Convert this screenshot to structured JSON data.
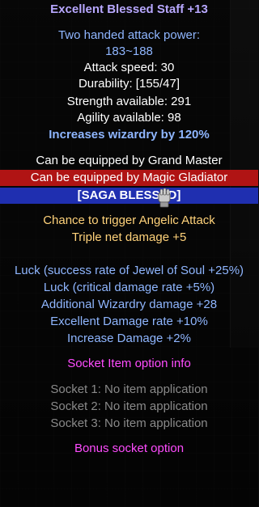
{
  "item": {
    "title": "Excellent Blessed Staff +13",
    "attack_power_label": "Two handed attack power:",
    "attack_power_value": "183~188",
    "attack_speed": "Attack speed: 30",
    "durability": "Durability: [155/47]",
    "strength": "Strength available: 291",
    "agility": "Agility available: 98",
    "wizardry": "Increases wizardry by 120%",
    "equip_grand_master": "Can be equipped by Grand Master",
    "equip_magic_gladiator": "Can be equipped by Magic Gladiator",
    "saga": "[SAGA BLESSED]",
    "angelic_attack": "Chance to trigger Angelic Attack",
    "triple_net": "Triple net damage +5",
    "luck_jewel": "Luck (success rate of Jewel of Soul +25%)",
    "luck_crit": "Luck (critical damage rate +5%)",
    "additional_wizardry": "Additional Wizardry damage +28",
    "excellent_rate": "Excellent Damage rate +10%",
    "increase_damage": "Increase Damage +2%",
    "socket_info": "Socket Item option info",
    "socket_1": "Socket 1: No item application",
    "socket_2": "Socket 2: No item application",
    "socket_3": "Socket 3: No item application",
    "bonus_socket": "Bonus socket option"
  },
  "colors": {
    "title": "#b8a8ff",
    "stat_blue": "#8fb6ff",
    "red_bar": "#b01414",
    "blue_bar": "#1f2fb0",
    "gold": "#ffd27a",
    "magenta": "#ff4cff",
    "gray": "#8a8a8a"
  },
  "icons": {
    "cursor": "gauntlet-cursor-icon"
  }
}
